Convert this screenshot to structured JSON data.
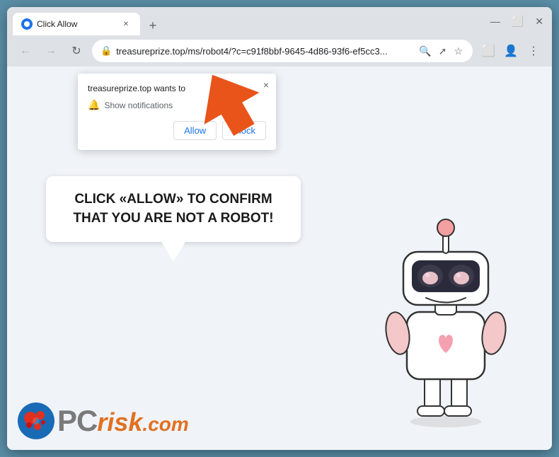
{
  "browser": {
    "tab_title": "Click Allow",
    "url": "treasureprize.top/ms/robot4/?c=c91f8bbf-9645-4d86-93f6-ef5cc3...",
    "url_display": "treasureprize.top/ms/robot4/?c=c91f8bbf-9645-4d86-93f6-ef5cc3...",
    "favicon_alt": "site icon"
  },
  "notification": {
    "site": "treasureprize.top wants to",
    "permission": "Show notifications",
    "allow_label": "Allow",
    "block_label": "Block",
    "close_label": "×"
  },
  "speech_bubble": {
    "text": "CLICK «ALLOW» TO CONFIRM THAT YOU ARE NOT A ROBOT!"
  },
  "logo": {
    "pc_text": "PC",
    "risk_text": "risk",
    "com_text": ".com"
  },
  "nav": {
    "back_label": "←",
    "forward_label": "→",
    "reload_label": "↻"
  },
  "toolbar": {
    "bookmarks_icon": "☆",
    "extensions_icon": "⚡",
    "profile_icon": "👤",
    "menu_icon": "⋮"
  }
}
